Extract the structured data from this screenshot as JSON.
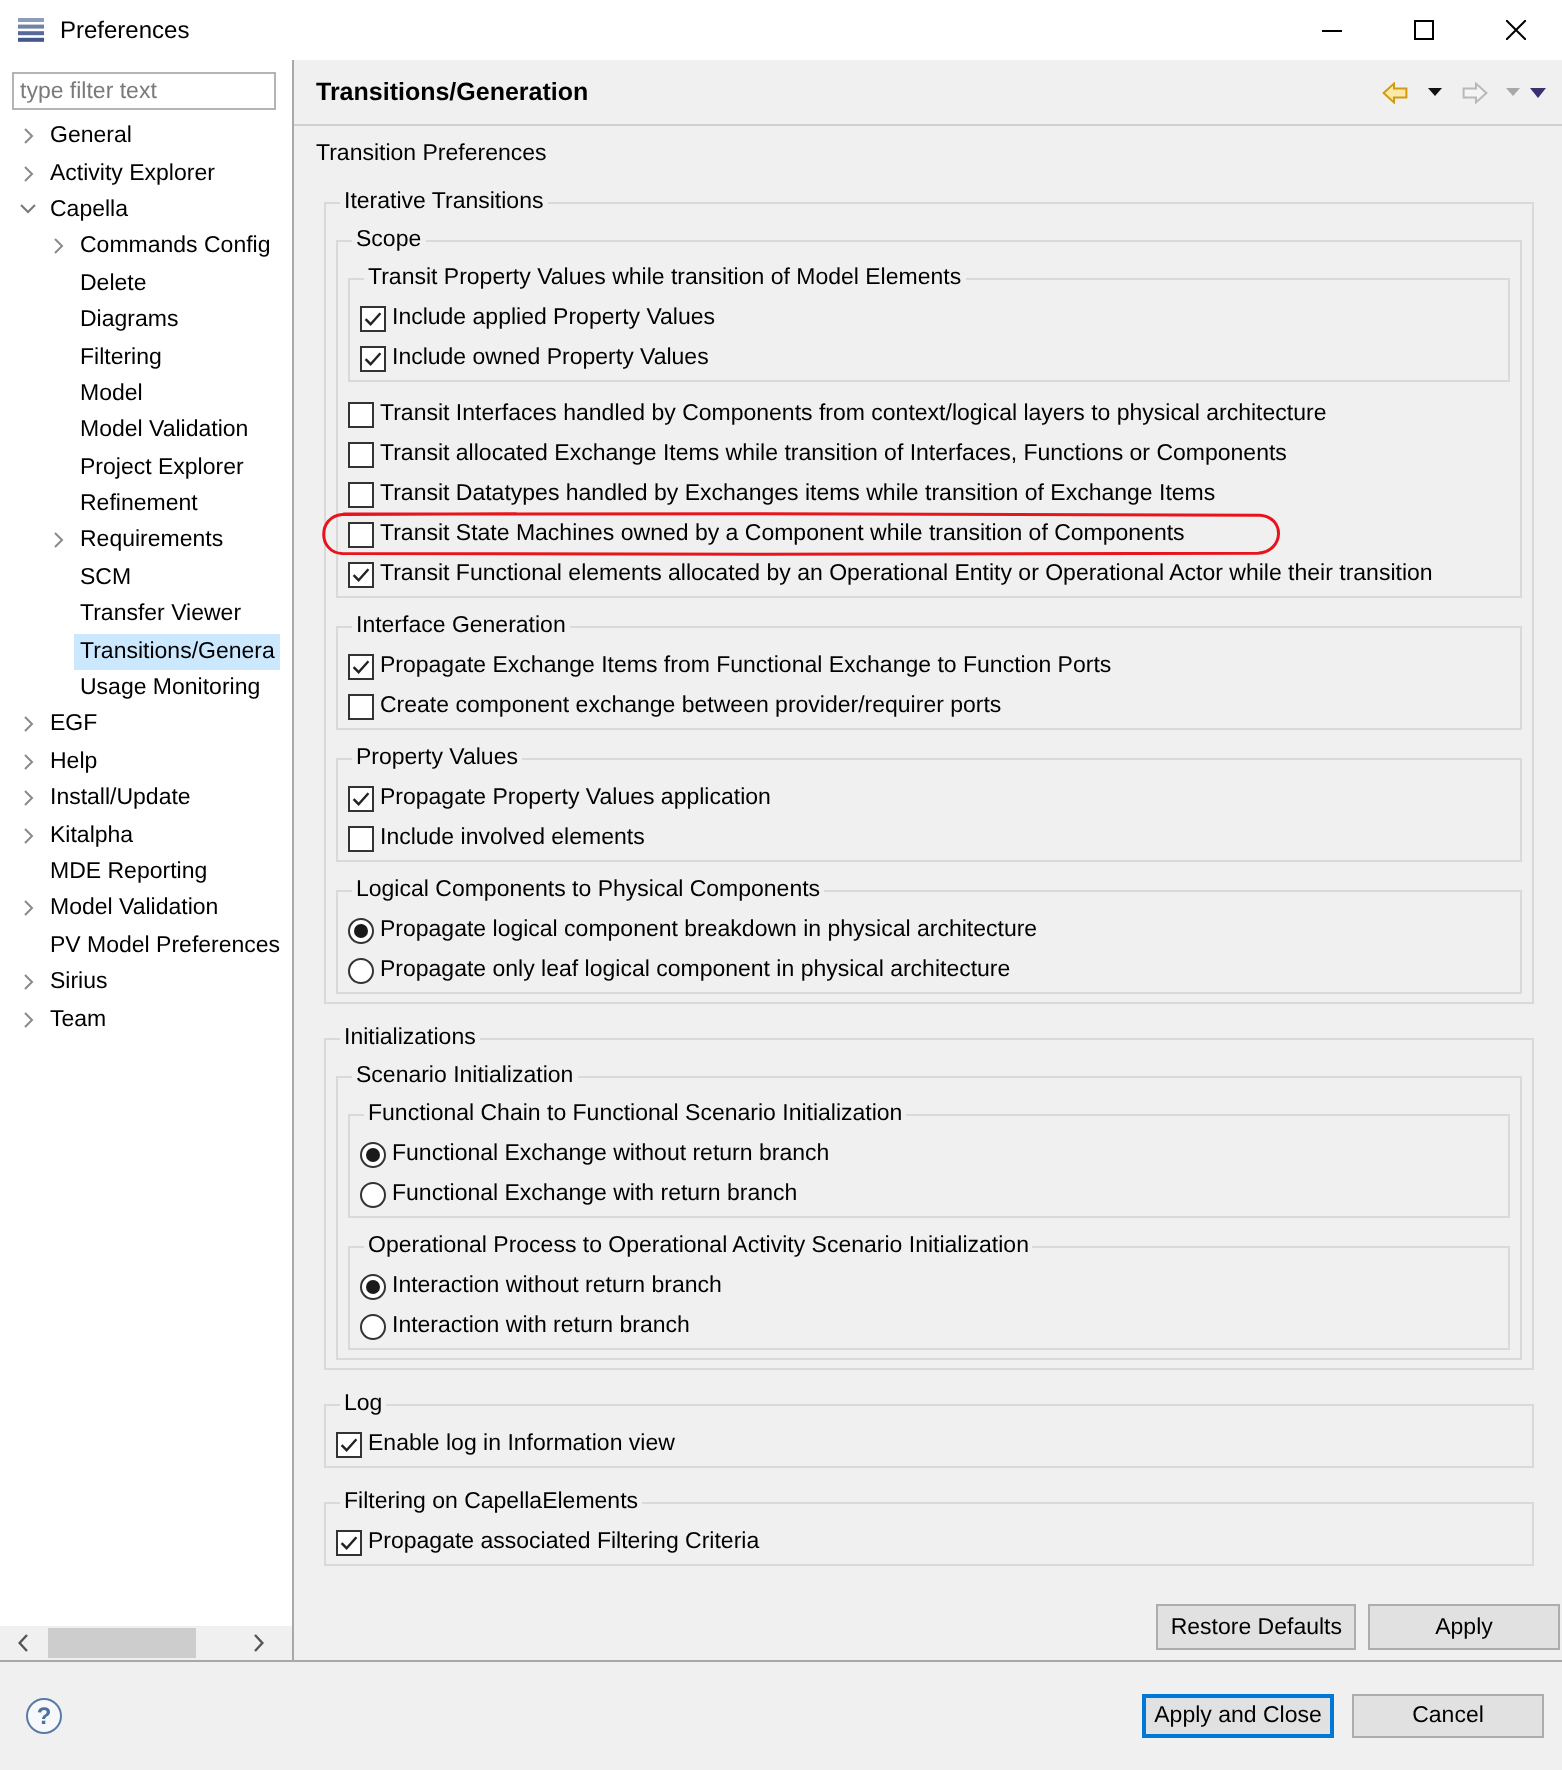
{
  "window": {
    "title": "Preferences"
  },
  "sidebar": {
    "filter": {
      "placeholder": "type filter text"
    },
    "tree": [
      {
        "label": "General",
        "expandable": true,
        "expanded": false,
        "selected": false
      },
      {
        "label": "Activity Explorer",
        "expandable": true,
        "expanded": false,
        "selected": false
      },
      {
        "label": "Capella",
        "expandable": true,
        "expanded": true,
        "selected": false,
        "children": [
          {
            "label": "Commands Config",
            "expandable": true,
            "expanded": false,
            "selected": false
          },
          {
            "label": "Delete",
            "expandable": false,
            "selected": false
          },
          {
            "label": "Diagrams",
            "expandable": false,
            "selected": false
          },
          {
            "label": "Filtering",
            "expandable": false,
            "selected": false
          },
          {
            "label": "Model",
            "expandable": false,
            "selected": false
          },
          {
            "label": "Model Validation",
            "expandable": false,
            "selected": false
          },
          {
            "label": "Project Explorer",
            "expandable": false,
            "selected": false
          },
          {
            "label": "Refinement",
            "expandable": false,
            "selected": false
          },
          {
            "label": "Requirements",
            "expandable": true,
            "expanded": false,
            "selected": false
          },
          {
            "label": "SCM",
            "expandable": false,
            "selected": false
          },
          {
            "label": "Transfer Viewer",
            "expandable": false,
            "selected": false
          },
          {
            "label": "Transitions/Genera",
            "expandable": false,
            "selected": true
          },
          {
            "label": "Usage Monitoring",
            "expandable": false,
            "selected": false
          }
        ]
      },
      {
        "label": "EGF",
        "expandable": true,
        "expanded": false,
        "selected": false
      },
      {
        "label": "Help",
        "expandable": true,
        "expanded": false,
        "selected": false
      },
      {
        "label": "Install/Update",
        "expandable": true,
        "expanded": false,
        "selected": false
      },
      {
        "label": "Kitalpha",
        "expandable": true,
        "expanded": false,
        "selected": false
      },
      {
        "label": "MDE Reporting",
        "expandable": false,
        "selected": false
      },
      {
        "label": "Model Validation",
        "expandable": true,
        "expanded": false,
        "selected": false
      },
      {
        "label": "PV Model Preferences",
        "expandable": false,
        "selected": false
      },
      {
        "label": "Sirius",
        "expandable": true,
        "expanded": false,
        "selected": false
      },
      {
        "label": "Team",
        "expandable": true,
        "expanded": false,
        "selected": false
      }
    ]
  },
  "page": {
    "title": "Transitions/Generation",
    "history": {
      "back_enabled": true,
      "forward_enabled": false
    },
    "description": "Transition Preferences",
    "groups": [
      {
        "kind": "group",
        "title": "Iterative Transitions",
        "items": [
          {
            "kind": "group",
            "title": "Scope",
            "items": [
              {
                "kind": "group",
                "title": "Transit Property Values while transition of Model Elements",
                "items": [
                  {
                    "kind": "checkbox",
                    "label": "Include applied Property Values",
                    "checked": true
                  },
                  {
                    "kind": "checkbox",
                    "label": "Include owned Property Values",
                    "checked": true
                  }
                ]
              },
              {
                "kind": "checkbox",
                "label": "Transit Interfaces handled by Components from context/logical layers to physical architecture",
                "checked": false,
                "highlighted": false
              },
              {
                "kind": "checkbox",
                "label": "Transit allocated Exchange Items while transition of Interfaces, Functions or Components",
                "checked": false,
                "highlighted": false
              },
              {
                "kind": "checkbox",
                "label": "Transit Datatypes handled by Exchanges items while transition of Exchange Items",
                "checked": false,
                "highlighted": false
              },
              {
                "kind": "checkbox",
                "label": "Transit State Machines owned by a Component while transition of Components",
                "checked": false,
                "highlighted": true
              },
              {
                "kind": "checkbox",
                "label": "Transit Functional elements allocated by an Operational Entity or Operational Actor while their transition",
                "checked": true,
                "highlighted": false
              }
            ]
          },
          {
            "kind": "group",
            "title": "Interface Generation",
            "items": [
              {
                "kind": "checkbox",
                "label": "Propagate Exchange Items from Functional Exchange to Function Ports",
                "checked": true
              },
              {
                "kind": "checkbox",
                "label": "Create component exchange between provider/requirer ports",
                "checked": false
              }
            ]
          },
          {
            "kind": "group",
            "title": "Property Values",
            "items": [
              {
                "kind": "checkbox",
                "label": "Propagate Property Values application",
                "checked": true
              },
              {
                "kind": "checkbox",
                "label": "Include involved elements",
                "checked": false
              }
            ]
          },
          {
            "kind": "group",
            "title": "Logical Components to Physical Components",
            "items": [
              {
                "kind": "radio",
                "label": "Propagate logical component breakdown in physical architecture",
                "selected": true
              },
              {
                "kind": "radio",
                "label": "Propagate only leaf logical component in physical architecture",
                "selected": false
              }
            ]
          }
        ]
      },
      {
        "kind": "group",
        "title": "Initializations",
        "items": [
          {
            "kind": "group",
            "title": "Scenario Initialization",
            "items": [
              {
                "kind": "group",
                "title": "Functional Chain to Functional Scenario Initialization",
                "items": [
                  {
                    "kind": "radio",
                    "label": "Functional Exchange without return branch",
                    "selected": true
                  },
                  {
                    "kind": "radio",
                    "label": "Functional Exchange with return branch",
                    "selected": false
                  }
                ]
              },
              {
                "kind": "group",
                "title": "Operational Process to Operational Activity Scenario Initialization",
                "items": [
                  {
                    "kind": "radio",
                    "label": "Interaction without return branch",
                    "selected": true
                  },
                  {
                    "kind": "radio",
                    "label": "Interaction with return branch",
                    "selected": false
                  }
                ]
              }
            ]
          }
        ]
      },
      {
        "kind": "group",
        "title": "Log",
        "items": [
          {
            "kind": "checkbox",
            "label": "Enable log in Information view",
            "checked": true
          }
        ]
      },
      {
        "kind": "group",
        "title": "Filtering on CapellaElements",
        "items": [
          {
            "kind": "checkbox",
            "label": "Propagate associated Filtering Criteria",
            "checked": true
          }
        ]
      }
    ],
    "buttons": [
      {
        "label": "Restore Defaults"
      },
      {
        "label": "Apply"
      }
    ]
  },
  "footer": {
    "help": {
      "label": "?"
    },
    "buttons": [
      {
        "label": "Apply and Close",
        "default": true
      },
      {
        "label": "Cancel",
        "default": false
      }
    ]
  }
}
